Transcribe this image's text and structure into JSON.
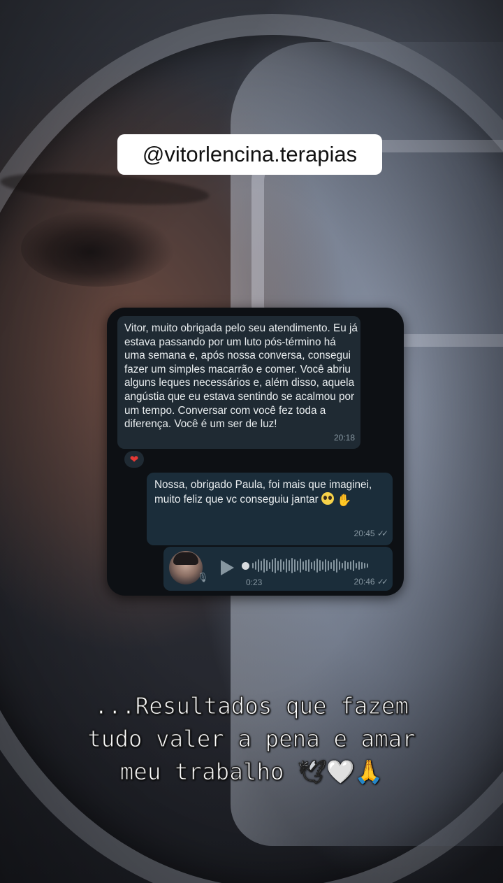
{
  "handle": "@vitorlencina.terapias",
  "chat": {
    "incoming": {
      "text": "Vitor, muito obrigada pelo seu atendimento. Eu já estava passando por um luto pós-término há uma semana e, após nossa conversa, consegui fazer um simples macarrão e comer. Você abriu alguns leques necessários e, além disso, aquela angústia que eu estava sentindo se acalmou por um tempo. Conversar com você fez toda a diferença. Você é um ser de luz!",
      "time": "20:18",
      "reaction": "❤"
    },
    "outgoing": {
      "line1": "Nossa, obrigado Paula, foi mais que imaginei,",
      "line2": "muito feliz que vc conseguiu jantar",
      "time": "20:45",
      "ticks": "✓✓"
    },
    "voice": {
      "duration": "0:23",
      "time": "20:46",
      "ticks": "✓✓",
      "mic": "🎙"
    }
  },
  "caption": {
    "line1": "...Resultados que fazem",
    "line2": "tudo valer a pena e amar",
    "line3": "meu trabalho",
    "emojis": [
      "🕊",
      "🤍",
      "🙏"
    ]
  },
  "icons": [
    "heart-reaction-icon",
    "smiling-face-icon",
    "clapping-hands-icon",
    "play-icon",
    "microphone-icon",
    "double-check-icon",
    "dove-icon",
    "white-heart-icon",
    "praying-hands-icon"
  ]
}
